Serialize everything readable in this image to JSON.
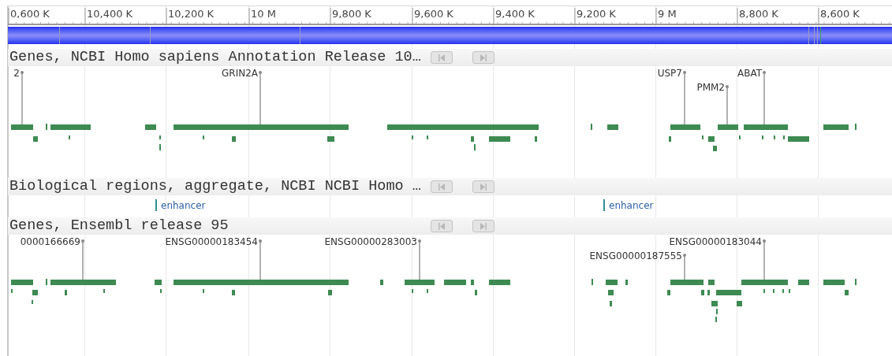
{
  "ruler": {
    "ticks": [
      "0,600 K",
      "10,400 K",
      "10,200 K",
      "10 M",
      "9,800 K",
      "9,600 K",
      "9,400 K",
      "9,200 K",
      "9 M",
      "8,800 K",
      "8,600 K"
    ]
  },
  "tracks": [
    {
      "kind": "genes",
      "title": "Genes, NCBI Homo sapiens Annotation Release 10…",
      "labels": [
        "2",
        "GRIN2A",
        "USP7",
        "PMM2",
        "ABAT"
      ]
    },
    {
      "kind": "regions",
      "title": "Biological regions, aggregate, NCBI NCBI Homo …",
      "labels": [
        "enhancer",
        "enhancer"
      ]
    },
    {
      "kind": "genes",
      "title": "Genes, Ensembl release 95",
      "labels": [
        "0000166669",
        "ENSG00000183454",
        "ENSG00000283003",
        "ENSG00000183044",
        "ENSG00000187555"
      ]
    }
  ]
}
